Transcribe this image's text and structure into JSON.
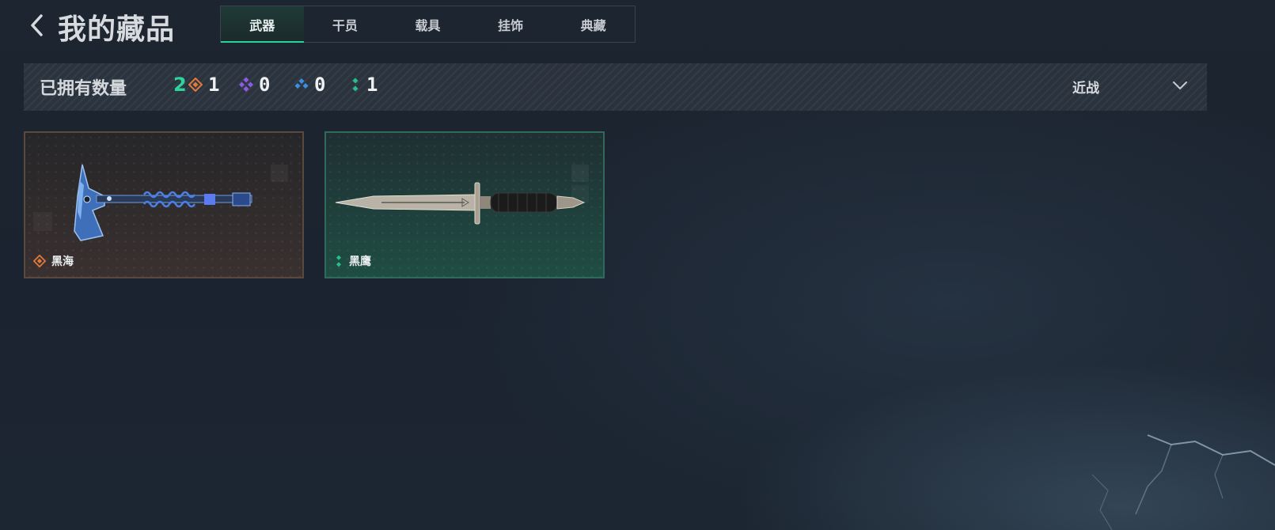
{
  "header": {
    "back_icon": "chevron-left-icon",
    "title": "我的藏品"
  },
  "tabs": [
    {
      "label": "武器",
      "active": true
    },
    {
      "label": "干员",
      "active": false
    },
    {
      "label": "载具",
      "active": false
    },
    {
      "label": "挂饰",
      "active": false
    },
    {
      "label": "典藏",
      "active": false
    }
  ],
  "summary": {
    "owned_label": "已拥有数量",
    "owned_count": "2",
    "rarity_counts": [
      {
        "icon": "orange-diamond-icon",
        "color": "#e07a3a",
        "count": "1"
      },
      {
        "icon": "purple-diamond-icon",
        "color": "#8c5ae6",
        "count": "0"
      },
      {
        "icon": "blue-diamond-icon",
        "color": "#3a8fe0",
        "count": "0"
      },
      {
        "icon": "green-diamond-icon",
        "color": "#27c08a",
        "count": "1"
      }
    ],
    "filter_value": "近战",
    "filter_icon": "chevron-down-icon"
  },
  "items": [
    {
      "name": "黑海",
      "rarity_color": "#e07a3a",
      "icon": "axe-icon"
    },
    {
      "name": "黑鹰",
      "rarity_color": "#27c08a",
      "icon": "knife-icon"
    }
  ],
  "colors": {
    "accent": "#26d39a",
    "owned_count": "#2cd59c"
  }
}
